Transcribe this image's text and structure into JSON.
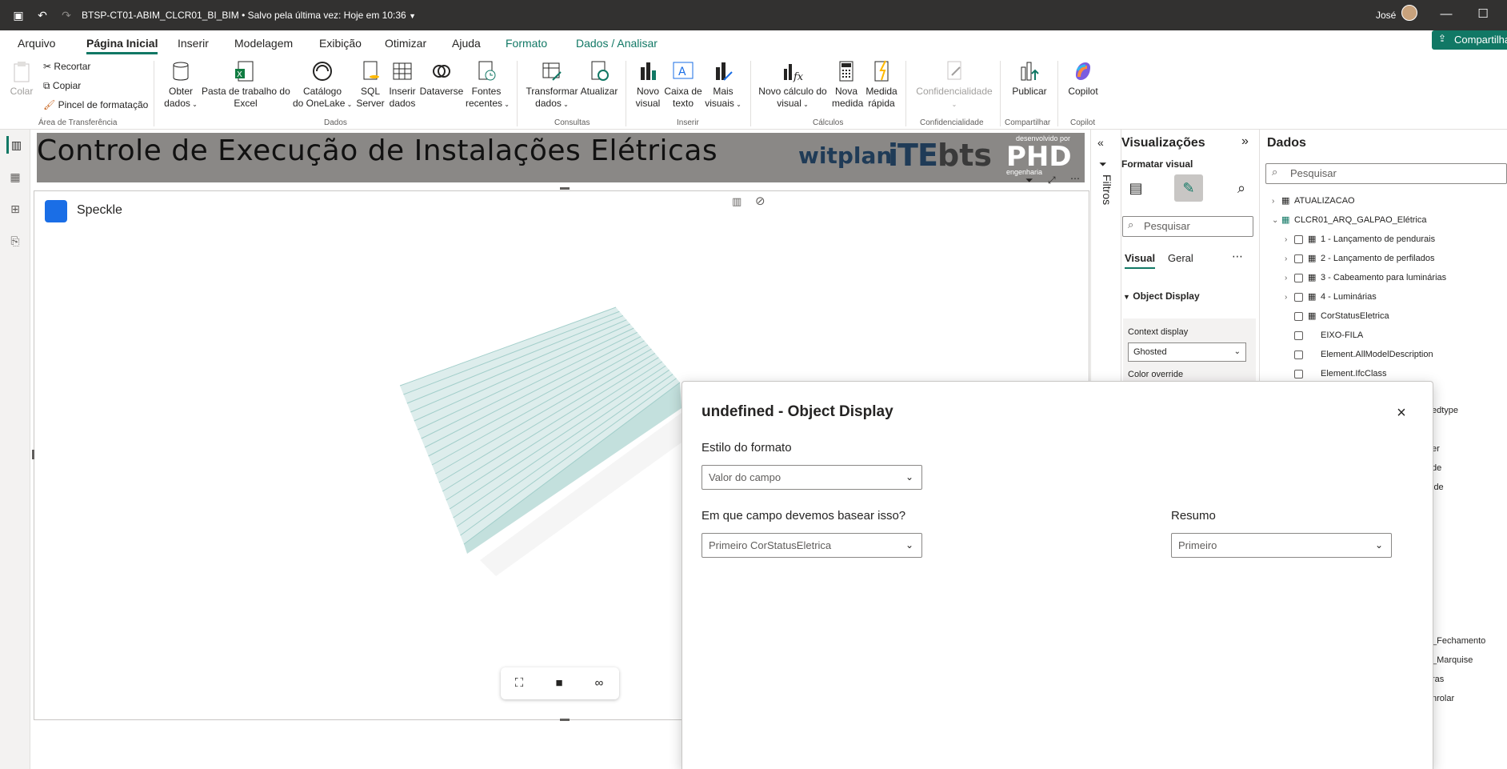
{
  "titlebar": {
    "doc_title": "BTSP-CT01-ABIM_CLCR01_BI_BIM",
    "save_status": "Salvo pela última vez: Hoje em 10:36",
    "user": "José"
  },
  "tabs": [
    "Arquivo",
    "Página Inicial",
    "Inserir",
    "Modelagem",
    "Exibição",
    "Otimizar",
    "Ajuda",
    "Formato",
    "Dados / Analisar"
  ],
  "share_label": "Compartilhar",
  "ribbon": {
    "clipboard": {
      "paste": "Colar",
      "cut": "Recortar",
      "copy": "Copiar",
      "format_painter": "Pincel de formatação",
      "group": "Área de Transferência"
    },
    "data": {
      "get_data": [
        "Obter",
        "dados"
      ],
      "excel": [
        "Pasta de trabalho do",
        "Excel"
      ],
      "onelake": [
        "Catálogo",
        "do OneLake"
      ],
      "sql": [
        "SQL",
        "Server"
      ],
      "enter": [
        "Inserir",
        "dados"
      ],
      "dataverse": "Dataverse",
      "recent": [
        "Fontes",
        "recentes"
      ],
      "group": "Dados"
    },
    "queries": {
      "transform": [
        "Transformar",
        "dados"
      ],
      "refresh": "Atualizar",
      "group": "Consultas"
    },
    "insert": {
      "new_visual": [
        "Novo",
        "visual"
      ],
      "text_box": [
        "Caixa de",
        "texto"
      ],
      "more_visuals": [
        "Mais",
        "visuais"
      ],
      "group": "Inserir"
    },
    "calculations": {
      "visual_calc": [
        "Novo cálculo do",
        "visual"
      ],
      "new_measure": [
        "Nova",
        "medida"
      ],
      "quick_measure": [
        "Medida",
        "rápida"
      ],
      "group": "Cálculos"
    },
    "sensitivity": {
      "label": "Confidencialidade",
      "group": "Confidencialidade"
    },
    "share": {
      "publish": "Publicar",
      "group": "Compartilhar"
    },
    "copilot": {
      "label": "Copilot",
      "group": "Copilot"
    }
  },
  "report": {
    "title": "Controle de Execução de Instalações Elétricas",
    "logos": {
      "witplan": "witplan",
      "bts": "bts",
      "phd_small": "desenvolvido por",
      "phd": "PHD",
      "phd_sub": "engenharia"
    },
    "visual_label": "Speckle"
  },
  "filters_label": "Filtros",
  "viz_pane": {
    "title": "Visualizações",
    "subtitle": "Formatar visual",
    "search_placeholder": "Pesquisar",
    "tab_visual": "Visual",
    "tab_general": "Geral",
    "section": "Object Display",
    "context_display_label": "Context display",
    "context_display_value": "Ghosted",
    "color_override_label": "Color override"
  },
  "data_pane": {
    "title": "Dados",
    "search_placeholder": "Pesquisar",
    "tables": [
      "ATUALIZACAO",
      "CLCR01_ARQ_GALPAO_Elétrica"
    ],
    "fields": [
      "1 - Lançamento de pendurais",
      "2 - Lançamento de perfilados",
      "3 - Cabeamento para luminárias",
      "4 - Luminárias",
      "CorStatusEletrica",
      "EIXO-FILA",
      "Element.AllModelDescription",
      "Element.IfcClass"
    ],
    "partial_fields": [
      "edtype",
      "er",
      "de",
      "ide",
      "_Fechamento",
      "_Marquise",
      "ras",
      "nrolar"
    ]
  },
  "dialog": {
    "title": "undefined - Object Display",
    "format_style_label": "Estilo do formato",
    "format_style_value": "Valor do campo",
    "field_label": "Em que campo devemos basear isso?",
    "field_value": "Primeiro CorStatusEletrica",
    "summary_label": "Resumo",
    "summary_value": "Primeiro"
  },
  "colors": {
    "accent": "#117865",
    "titlebar": "#323130",
    "banner": "#8a8886",
    "model": "#a8d4d0",
    "speckle": "#1a6ee6"
  }
}
